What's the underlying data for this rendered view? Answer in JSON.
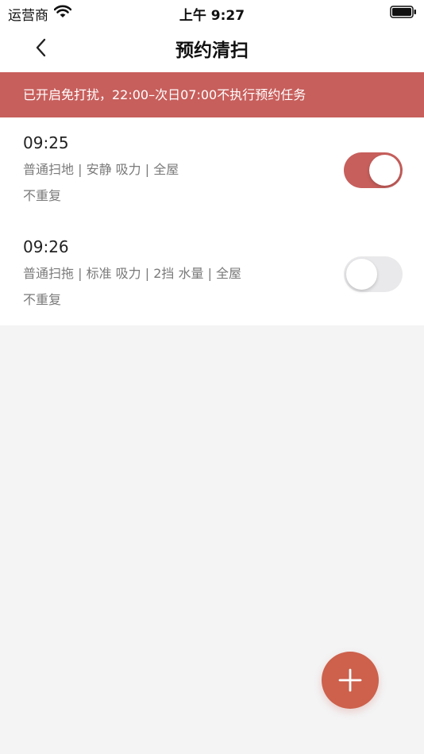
{
  "status_bar": {
    "carrier": "运营商",
    "time": "上午 9:27"
  },
  "nav": {
    "title": "预约清扫",
    "back_icon": "chevron-left-icon"
  },
  "banner": {
    "text": "已开启免打扰，22:00–次日07:00不执行预约任务",
    "color": "#c75f5c"
  },
  "schedules": [
    {
      "time": "09:25",
      "detail": "普通扫地 | 安静 吸力 | 全屋",
      "repeat": "不重复",
      "enabled": true
    },
    {
      "time": "09:26",
      "detail": "普通扫拖 | 标准 吸力 | 2挡 水量 | 全屋",
      "repeat": "不重复",
      "enabled": false
    }
  ],
  "fab": {
    "icon": "plus-icon",
    "color": "#cd614c"
  },
  "colors": {
    "accent": "#c75f5c",
    "background": "#f4f4f5",
    "toggle_off": "#e9e9eb"
  }
}
